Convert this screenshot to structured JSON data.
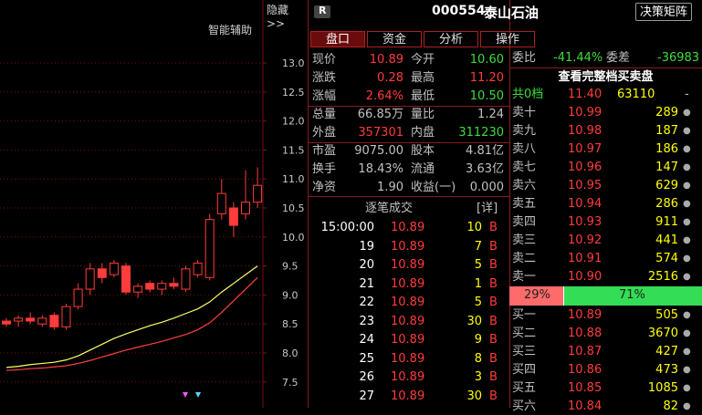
{
  "chart": {
    "hide_label": "隐藏>>",
    "assist_label": "智能辅助",
    "price_ticks": [
      "13.0",
      "12.5",
      "12.0",
      "11.5",
      "11.0",
      "10.5",
      "10.0",
      "9.5",
      "9.0",
      "8.5",
      "8.0",
      "7.5"
    ],
    "candles": [
      {
        "o": 8.55,
        "h": 8.6,
        "l": 8.45,
        "c": 8.5,
        "up": false
      },
      {
        "o": 8.55,
        "h": 8.65,
        "l": 8.45,
        "c": 8.6,
        "up": true
      },
      {
        "o": 8.6,
        "h": 8.7,
        "l": 8.5,
        "c": 8.55,
        "up": false
      },
      {
        "o": 8.5,
        "h": 8.65,
        "l": 8.45,
        "c": 8.6,
        "up": true
      },
      {
        "o": 8.65,
        "h": 8.7,
        "l": 8.4,
        "c": 8.45,
        "up": false
      },
      {
        "o": 8.45,
        "h": 8.85,
        "l": 8.4,
        "c": 8.8,
        "up": true
      },
      {
        "o": 8.8,
        "h": 9.2,
        "l": 8.75,
        "c": 9.1,
        "up": true
      },
      {
        "o": 9.1,
        "h": 9.55,
        "l": 9.0,
        "c": 9.45,
        "up": true
      },
      {
        "o": 9.45,
        "h": 9.55,
        "l": 9.2,
        "c": 9.3,
        "up": false
      },
      {
        "o": 9.35,
        "h": 9.6,
        "l": 9.3,
        "c": 9.55,
        "up": true
      },
      {
        "o": 9.5,
        "h": 9.55,
        "l": 9.0,
        "c": 9.05,
        "up": false
      },
      {
        "o": 9.05,
        "h": 9.2,
        "l": 8.95,
        "c": 9.15,
        "up": true
      },
      {
        "o": 9.2,
        "h": 9.25,
        "l": 9.05,
        "c": 9.1,
        "up": false
      },
      {
        "o": 9.1,
        "h": 9.25,
        "l": 9.0,
        "c": 9.2,
        "up": true
      },
      {
        "o": 9.2,
        "h": 9.3,
        "l": 9.1,
        "c": 9.15,
        "up": false
      },
      {
        "o": 9.1,
        "h": 9.5,
        "l": 9.05,
        "c": 9.45,
        "up": true
      },
      {
        "o": 9.35,
        "h": 9.6,
        "l": 9.3,
        "c": 9.55,
        "up": true
      },
      {
        "o": 9.3,
        "h": 10.4,
        "l": 9.25,
        "c": 10.3,
        "up": true
      },
      {
        "o": 10.4,
        "h": 11.0,
        "l": 10.3,
        "c": 10.75,
        "up": true
      },
      {
        "o": 10.5,
        "h": 10.6,
        "l": 10.0,
        "c": 10.2,
        "up": false
      },
      {
        "o": 10.4,
        "h": 11.15,
        "l": 10.3,
        "c": 10.6,
        "up": true
      },
      {
        "o": 10.6,
        "h": 11.2,
        "l": 10.5,
        "c": 10.89,
        "up": true
      }
    ],
    "ma_short": [
      7.75,
      7.77,
      7.8,
      7.82,
      7.84,
      7.88,
      7.95,
      8.05,
      8.15,
      8.25,
      8.33,
      8.4,
      8.47,
      8.53,
      8.6,
      8.68,
      8.76,
      8.88,
      9.05,
      9.2,
      9.35,
      9.5
    ],
    "ma_long": [
      7.7,
      7.71,
      7.73,
      7.74,
      7.76,
      7.78,
      7.82,
      7.87,
      7.93,
      7.99,
      8.05,
      8.1,
      8.15,
      8.2,
      8.26,
      8.32,
      8.4,
      8.52,
      8.7,
      8.9,
      9.1,
      9.3
    ]
  },
  "header": {
    "badge": "R",
    "code": "000554",
    "name": "泰山石油",
    "decision_button": "决策矩阵"
  },
  "tabs": [
    "盘口",
    "资金",
    "分析",
    "操作"
  ],
  "quote": [
    {
      "l1": "现价",
      "v1": "10.89",
      "c1": "red",
      "l2": "今开",
      "v2": "10.60",
      "c2": "green"
    },
    {
      "l1": "涨跌",
      "v1": "0.28",
      "c1": "red",
      "l2": "最高",
      "v2": "11.20",
      "c2": "red"
    },
    {
      "l1": "涨幅",
      "v1": "2.64%",
      "c1": "red",
      "l2": "最低",
      "v2": "10.50",
      "c2": "green"
    },
    {
      "l1": "总量",
      "v1": "66.85万",
      "c1": "grey",
      "l2": "量比",
      "v2": "1.24",
      "c2": "grey"
    },
    {
      "l1": "外盘",
      "v1": "357301",
      "c1": "red",
      "l2": "内盘",
      "v2": "311230",
      "c2": "green"
    },
    {
      "l1": "市盈",
      "v1": "9075.00",
      "c1": "grey",
      "l2": "股本",
      "v2": "4.81亿",
      "c2": "grey"
    },
    {
      "l1": "换手",
      "v1": "18.43%",
      "c1": "grey",
      "l2": "流通",
      "v2": "3.63亿",
      "c2": "grey"
    },
    {
      "l1": "净资",
      "v1": "1.90",
      "c1": "grey",
      "l2": "收益(一)",
      "v2": "0.000",
      "c2": "grey"
    }
  ],
  "trades_header": {
    "title": "逐笔成交",
    "detail": "[详]"
  },
  "trades": [
    {
      "time": "15:00:00",
      "price": "10.89",
      "vol": "10",
      "side": "B"
    },
    {
      "time": "19",
      "price": "10.89",
      "vol": "7",
      "side": "B"
    },
    {
      "time": "20",
      "price": "10.89",
      "vol": "5",
      "side": "B"
    },
    {
      "time": "21",
      "price": "10.89",
      "vol": "1",
      "side": "B"
    },
    {
      "time": "22",
      "price": "10.89",
      "vol": "5",
      "side": "B"
    },
    {
      "time": "23",
      "price": "10.89",
      "vol": "30",
      "side": "B"
    },
    {
      "time": "24",
      "price": "10.89",
      "vol": "9",
      "side": "B"
    },
    {
      "time": "25",
      "price": "10.89",
      "vol": "8",
      "side": "B"
    },
    {
      "time": "26",
      "price": "10.89",
      "vol": "3",
      "side": "B"
    },
    {
      "time": "27",
      "price": "10.89",
      "vol": "30",
      "side": "B"
    }
  ],
  "orderbook": {
    "weibi_label": "委比",
    "weibi_value": "-41.44%",
    "weicha_label": "委差",
    "weicha_value": "-36983",
    "full_link": "查看完整档买卖盘",
    "top": {
      "label": "共0档",
      "price": "11.40",
      "vol": "63110",
      "mark": "-"
    },
    "asks": [
      {
        "label": "卖十",
        "price": "10.99",
        "vol": "289"
      },
      {
        "label": "卖九",
        "price": "10.98",
        "vol": "187"
      },
      {
        "label": "卖八",
        "price": "10.97",
        "vol": "186"
      },
      {
        "label": "卖七",
        "price": "10.96",
        "vol": "147"
      },
      {
        "label": "卖六",
        "price": "10.95",
        "vol": "629"
      },
      {
        "label": "卖五",
        "price": "10.94",
        "vol": "286"
      },
      {
        "label": "卖四",
        "price": "10.93",
        "vol": "911"
      },
      {
        "label": "卖三",
        "price": "10.92",
        "vol": "441"
      },
      {
        "label": "卖二",
        "price": "10.91",
        "vol": "574"
      },
      {
        "label": "卖一",
        "price": "10.90",
        "vol": "2516"
      }
    ],
    "ratio": {
      "sell": "29%",
      "buy": "71%",
      "sell_frac": 0.29
    },
    "bids": [
      {
        "label": "买一",
        "price": "10.89",
        "vol": "505"
      },
      {
        "label": "买二",
        "price": "10.88",
        "vol": "3670"
      },
      {
        "label": "买三",
        "price": "10.87",
        "vol": "427"
      },
      {
        "label": "买四",
        "price": "10.86",
        "vol": "473"
      },
      {
        "label": "买五",
        "price": "10.85",
        "vol": "1085"
      },
      {
        "label": "买六",
        "price": "10.84",
        "vol": "82"
      }
    ]
  },
  "colors": {
    "up": "#ff3b3b",
    "down": "#3ddc3d",
    "ma_short": "#ffff66",
    "ma_long": "#ff4040",
    "grid": "#7a1010"
  }
}
